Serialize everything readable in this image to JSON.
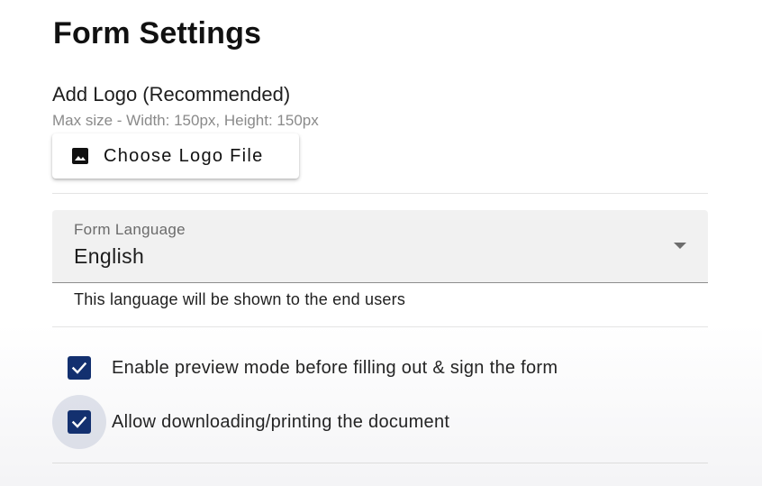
{
  "page": {
    "title": "Form Settings"
  },
  "logo": {
    "label": "Add Logo (Recommended)",
    "hint": "Max size - Width: 150px, Height: 150px",
    "button_label": "Choose Logo File",
    "button_icon": "image-icon"
  },
  "language": {
    "label": "Form Language",
    "value": "English",
    "helper": "This language will be shown to the end users",
    "caret_icon": "dropdown-arrow-icon"
  },
  "options": [
    {
      "label": "Enable preview mode before filling out & sign the form",
      "checked": true
    },
    {
      "label": "Allow downloading/printing the document",
      "checked": true
    }
  ],
  "colors": {
    "checkbox_fill": "#13306f",
    "select_background": "#f1f1f1"
  }
}
